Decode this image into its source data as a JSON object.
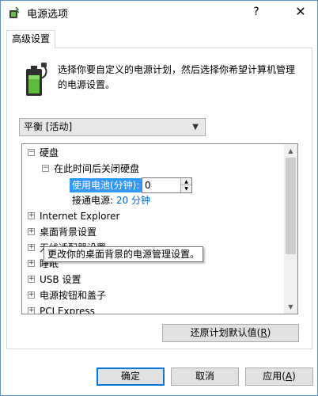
{
  "window": {
    "title": "电源选项",
    "help": "?",
    "close": "✕"
  },
  "tabs": [
    {
      "label": "高级设置",
      "active": true
    }
  ],
  "description": "选择你要自定义的电源计划，然后选择你希望计算机管理的电源设置。",
  "plan_select": {
    "value": "平衡 [活动]"
  },
  "tree": {
    "hard_disk": "硬盘",
    "turn_off_disk": "在此时间后关闭硬盘",
    "on_battery_label": "使用电池(分钟):",
    "on_battery_value": "0",
    "plugged_in_label": "接通电源:",
    "plugged_in_value": "20 分钟",
    "items": [
      "Internet Explorer",
      "桌面背景设置",
      "无线适配器设置",
      "睡眠",
      "USB 设置",
      "电源按钮和盖子",
      "PCI Express"
    ]
  },
  "tooltip": "更改你的桌面背景的电源管理设置。",
  "buttons": {
    "restore_prefix": "还原计划默认值(",
    "restore_key": "R",
    "restore_suffix": ")",
    "ok": "确定",
    "cancel": "取消",
    "apply_prefix": "应用(",
    "apply_key": "A",
    "apply_suffix": ")"
  },
  "icons": {
    "app": "power-options-icon",
    "battery": "battery-plug-icon"
  },
  "colors": {
    "selection": "#3399ff",
    "link_value": "#0066cc",
    "window_border": "#5a8fc9"
  }
}
